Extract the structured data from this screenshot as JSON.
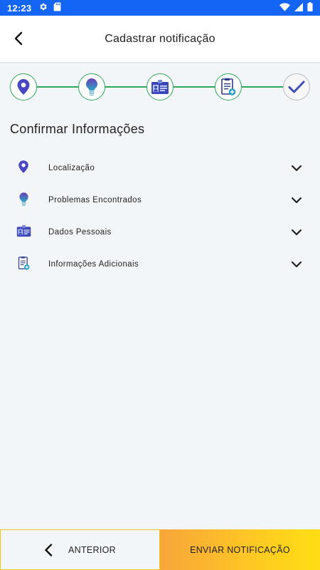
{
  "statusbar": {
    "time": "12:23"
  },
  "appbar": {
    "title": "Cadastrar notificação"
  },
  "section": {
    "title": "Confirmar Informações"
  },
  "stepper": {
    "steps": [
      {
        "icon": "location-pin-icon"
      },
      {
        "icon": "lightbulb-icon"
      },
      {
        "icon": "id-card-icon"
      },
      {
        "icon": "document-add-icon"
      },
      {
        "icon": "checkmark-icon"
      }
    ],
    "accent": "#2fa860"
  },
  "sections": [
    {
      "label": "Localização",
      "icon": "location-pin-icon"
    },
    {
      "label": "Problemas Encontrados",
      "icon": "lightbulb-icon"
    },
    {
      "label": "Dados Pessoais",
      "icon": "id-card-icon"
    },
    {
      "label": "Informações Adicionais",
      "icon": "document-add-icon"
    }
  ],
  "footer": {
    "previous_label": "ANTERIOR",
    "send_label": "ENVIAR NOTIFICAÇÃO"
  },
  "colors": {
    "status_bar": "#1565f5",
    "step_border": "#2fa860",
    "icon_purple": "#5a3fb5",
    "send_gradient_start": "#f8a53a",
    "send_gradient_end": "#ffde14"
  }
}
